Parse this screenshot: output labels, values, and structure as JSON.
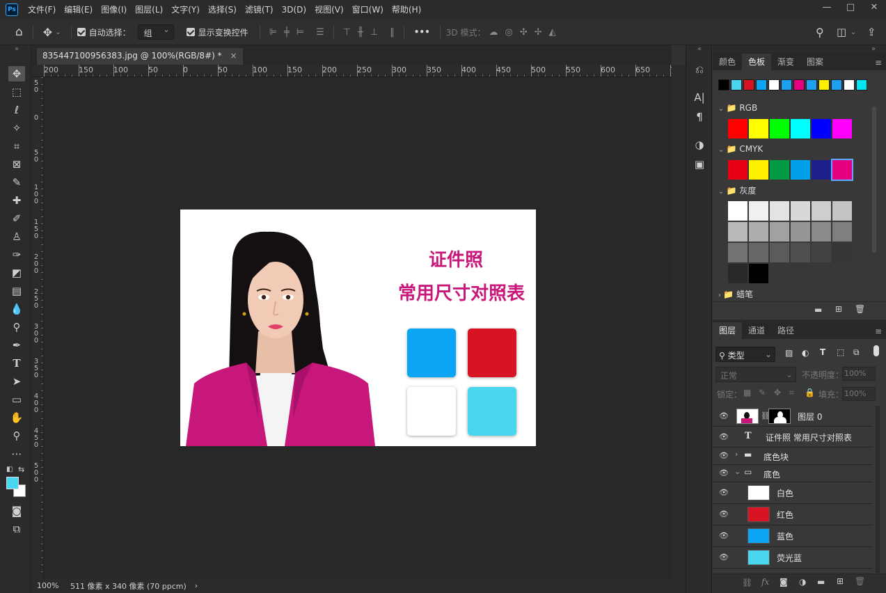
{
  "app": {
    "logo_text": "Ps"
  },
  "menu": [
    "文件(F)",
    "编辑(E)",
    "图像(I)",
    "图层(L)",
    "文字(Y)",
    "选择(S)",
    "滤镜(T)",
    "3D(D)",
    "视图(V)",
    "窗口(W)",
    "帮助(H)"
  ],
  "window_controls": {
    "minimize": "—",
    "maximize": "□",
    "close": "✕"
  },
  "options": {
    "auto_select_label": "自动选择：",
    "auto_select_value": "组",
    "show_transform_label": "显示变换控件",
    "more": "•••",
    "mode_3d_label": "3D 模式："
  },
  "document": {
    "tab_title": "835447100956383.jpg @ 100%(RGB/8#) *",
    "close": "×"
  },
  "ruler": {
    "h_ticks": [
      "200",
      "150",
      "100",
      "50",
      "0",
      "50",
      "100",
      "150",
      "200",
      "250",
      "300",
      "350",
      "400",
      "450",
      "500",
      "550",
      "600",
      "650",
      "7"
    ],
    "v_ticks": [
      "5\n0",
      "0",
      "5\n0",
      "1\n0\n0",
      "1\n5\n0",
      "2\n0\n0",
      "2\n5\n0",
      "3\n0\n0",
      "3\n5\n0",
      "4\n0\n0",
      "4\n5\n0",
      "5\n0\n0"
    ]
  },
  "artwork": {
    "title_line1": "证件照",
    "title_line2": "常用尺寸对照表",
    "title_color": "#c8177a",
    "blocks": [
      "#0aa5f5",
      "#d81424",
      "#ffffff",
      "#4bd6f0"
    ]
  },
  "status": {
    "zoom": "100%",
    "size": "511 像素 x 340 像素 (70 ppcm)",
    "arrow": "›"
  },
  "colors": {
    "fg": "#4bd6f0",
    "bg": "#ffffff"
  },
  "swatches_panel": {
    "tabs": [
      "颜色",
      "色板",
      "渐变",
      "图案"
    ],
    "active_tab": "色板",
    "recent": [
      "#000000",
      "#4bd6f0",
      "#d81424",
      "#0aa5f5",
      "#ffffff",
      "#1ea0f0",
      "#e4007f",
      "#1ea0f0",
      "#fff100",
      "#1ea0f0",
      "#ffffff",
      "#00e5ee"
    ],
    "groups": [
      {
        "name": "RGB",
        "swatches": [
          "#ff0000",
          "#ffff00",
          "#00ff00",
          "#00ffff",
          "#0000ff",
          "#ff00ff"
        ]
      },
      {
        "name": "CMYK",
        "swatches": [
          "#e60012",
          "#fff100",
          "#009944",
          "#00a0e9",
          "#1d2088",
          "#e4007f"
        ]
      },
      {
        "name": "灰度",
        "swatches": [
          "#ffffff",
          "#f0f0f0",
          "#e3e3e3",
          "#d8d8d8",
          "#cecece",
          "#c4c4c4",
          "#b9b9b9",
          "#adadad",
          "#a1a1a1",
          "#959595",
          "#8a8a8a",
          "#7f7f7f",
          "#737373",
          "#676767",
          "#5b5b5b",
          "#4f4f4f",
          "#434343",
          "#363636",
          "#292929",
          "#000000"
        ]
      },
      {
        "name": "蜡笔",
        "swatches": []
      }
    ]
  },
  "layers_panel": {
    "tabs": [
      "图层",
      "通道",
      "路径"
    ],
    "active_tab": "图层",
    "filter_label": "类型",
    "blend_mode": "正常",
    "opacity_label": "不透明度：",
    "opacity_value": "100%",
    "lock_label": "锁定：",
    "fill_label": "填充：",
    "fill_value": "100%",
    "layers": [
      {
        "name": "图层 0",
        "kind": "image"
      },
      {
        "name": "证件照 常用尺寸对照表",
        "kind": "text",
        "glyph": "T"
      },
      {
        "name": "底色块",
        "kind": "group-collapsed"
      },
      {
        "name": "底色",
        "kind": "group-open"
      },
      {
        "name": "白色",
        "kind": "fill",
        "color": "#ffffff"
      },
      {
        "name": "红色",
        "kind": "fill",
        "color": "#d81424"
      },
      {
        "name": "蓝色",
        "kind": "fill",
        "color": "#0aa5f5"
      },
      {
        "name": "荧光蓝",
        "kind": "fill",
        "color": "#4bd6f0"
      }
    ],
    "bottom_icons": [
      "link-icon",
      "fx-icon",
      "mask-icon",
      "adjustment-icon",
      "folder-icon",
      "new-layer-icon",
      "trash-icon"
    ]
  }
}
